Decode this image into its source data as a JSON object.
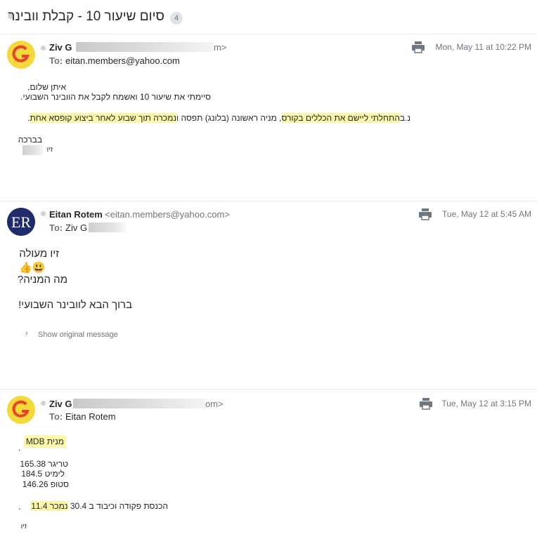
{
  "thread": {
    "subject": "סיום שיעור 10 - קבלת וובינר",
    "count": "4"
  },
  "messages": [
    {
      "avatar_letter": "G",
      "sender_name": "Ziv G",
      "sender_email_end": "m>",
      "to_label": "To:",
      "to_value": "eitan.members@yahoo.com",
      "date": "Mon, May 11 at 10:22 PM",
      "body": {
        "line1": "איתן שלום,",
        "line2": "סיימתי את שיעור 10 ואשמח לקבל את הוובינר השבועי.",
        "ps_prefix": "נ.ב",
        "ps_hl1": "התחלתי ליישם את הכללים בקורס",
        "ps_mid": ", מניה ראשונה (בלונג) תפסה ו",
        "ps_hl2": "נמכרה תוך שבוע לאחר ביצוע קופסא אחת",
        "ps_end": ".",
        "closing": "בברכה",
        "signature": "זיו"
      }
    },
    {
      "avatar_letters": "ER",
      "sender_name": "Eitan Rotem",
      "sender_email": "<eitan.members@yahoo.com>",
      "to_label": "To:",
      "to_value": "Ziv G",
      "date": "Tue, May 12 at 5:45 AM",
      "body": {
        "line1": "זיו מעולה",
        "emoji": "👍😃",
        "line2": "מה המניה?",
        "line3": "ברוך הבא לוובינר השבועי!"
      },
      "show_original": "Show original message"
    },
    {
      "avatar_letter": "G",
      "sender_name": "Ziv G",
      "sender_email_end": "om>",
      "to_label": "To:",
      "to_value": "Eitan Rotem",
      "date": "Tue, May 12 at 3:15 PM",
      "body": {
        "stock": "מנית MDB",
        "stock_dot": ".",
        "trigger": "טריגר 165.38",
        "limit": "לימיט 184.5",
        "stop": "סטופ 146.26",
        "entry_text": "הכנסת פקודה וכיבוד ב 30.4",
        "sold_hl": "נמכר 11.4",
        "sold_dot": ".",
        "signature": "זיו"
      }
    }
  ],
  "colors": {
    "highlight": "#fff7a8",
    "avatar_g_bg": "#f5d83a",
    "avatar_g_letter": "#e8432a",
    "avatar_er_bg": "#1f2b6b"
  },
  "icons": [
    "print-icon",
    "chevron-right-icon",
    "unread-dot-icon"
  ]
}
